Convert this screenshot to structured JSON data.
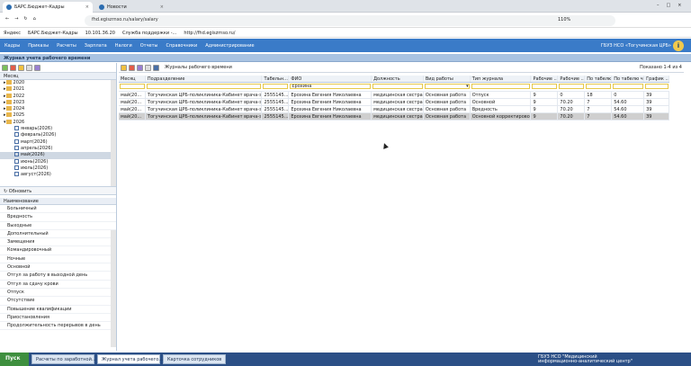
{
  "browser": {
    "tabs": [
      {
        "label": "БАРС.Бюджет-Кадры"
      },
      {
        "label": "Новости"
      }
    ],
    "url": "fhd.egiszrnso.ru/salary/salary",
    "zoom": "110%",
    "bookmarks": [
      "Яндекс",
      "БАРС.Бюджет-Кадры",
      "10.101.36.20",
      "Служба поддержки -...",
      "http://fhd.egiszrnso.ru/"
    ]
  },
  "menu": {
    "items": [
      "Кадры",
      "Приказы",
      "Расчеты",
      "Зарплата",
      "Налоги",
      "Отчеты",
      "Справочники",
      "Администрирование"
    ],
    "org": "ГБУЗ НСО «Тогучинская ЦРБ»"
  },
  "window": {
    "title": "Журнал учета рабочего времени"
  },
  "left": {
    "col_header": "Месяц",
    "years": [
      "2020",
      "2021",
      "2022",
      "2023",
      "2024",
      "2025",
      "2026"
    ],
    "months": [
      "январь(2026)",
      "февраль(2026)",
      "март(2026)",
      "апрель(2026)",
      "май(2026)",
      "июнь(2026)",
      "июль(2026)",
      "август(2026)"
    ],
    "refresh": "Обновить",
    "list_header": "Наименование",
    "types": [
      "Больничный",
      "Вредность",
      "Выходные",
      "Дополнительный",
      "Замещения",
      "Командировочный",
      "Ночные",
      "Основной",
      "Отгул за работу в выходной день",
      "Отгул за сдачу крови",
      "Отпуск",
      "Отсутствие",
      "Повышение квалификации",
      "Приостановления",
      "Продолжительность перерывов в день"
    ]
  },
  "right": {
    "toolbar_title": "Журналы рабочего времени",
    "paging": "Показано 1-4 из 4",
    "columns": [
      "Месяц",
      "Подразделение",
      "Табельн...",
      "ФИО",
      "Должность",
      "Вид работы",
      "Тип журнала",
      "Рабочие ...",
      "Рабочие ...",
      "По табелю ...",
      "По табелю ч...",
      "График ..."
    ],
    "filter_fio": "Ерохина",
    "rows": [
      [
        "май(20...",
        "Тогучинская ЦРБ-поликлиника-Кабинет врача-эпидеми...",
        "2555145...",
        "Ерохина Евгения Николаевна",
        "медицинская сестра",
        "Основная работа",
        "Отпуск",
        "9",
        "0",
        "18",
        "0",
        "39"
      ],
      [
        "май(20...",
        "Тогучинская ЦРБ-поликлиника-Кабинет врача-эпидеми...",
        "2555145...",
        "Ерохина Евгения Николаевна",
        "медицинская сестра",
        "Основная работа",
        "Основной",
        "9",
        "70.20",
        "7",
        "54.60",
        "39"
      ],
      [
        "май(20...",
        "Тогучинская ЦРБ-поликлиника-Кабинет врача-эпидеми...",
        "2555145...",
        "Ерохина Евгения Николаевна",
        "медицинская сестра",
        "Основная работа",
        "Вредность",
        "9",
        "70.20",
        "7",
        "54.60",
        "39"
      ],
      [
        "май(20...",
        "Тогучинская ЦРБ-поликлиника-Кабинет врача-эпидеми...",
        "2555145...",
        "Ерохина Евгения Николаевна",
        "медицинская сестра",
        "Основная работа",
        "Основной корректировоч...",
        "9",
        "70.20",
        "7",
        "54.60",
        "39"
      ]
    ]
  },
  "taskbar": {
    "start": "Пуск",
    "tasks": [
      "Расчеты по заработной...",
      "Журнал учета рабочего...",
      "Карточка сотрудников"
    ],
    "status": "ГБУЗ НСО \"Медицинский информационно-аналитический центр\""
  }
}
